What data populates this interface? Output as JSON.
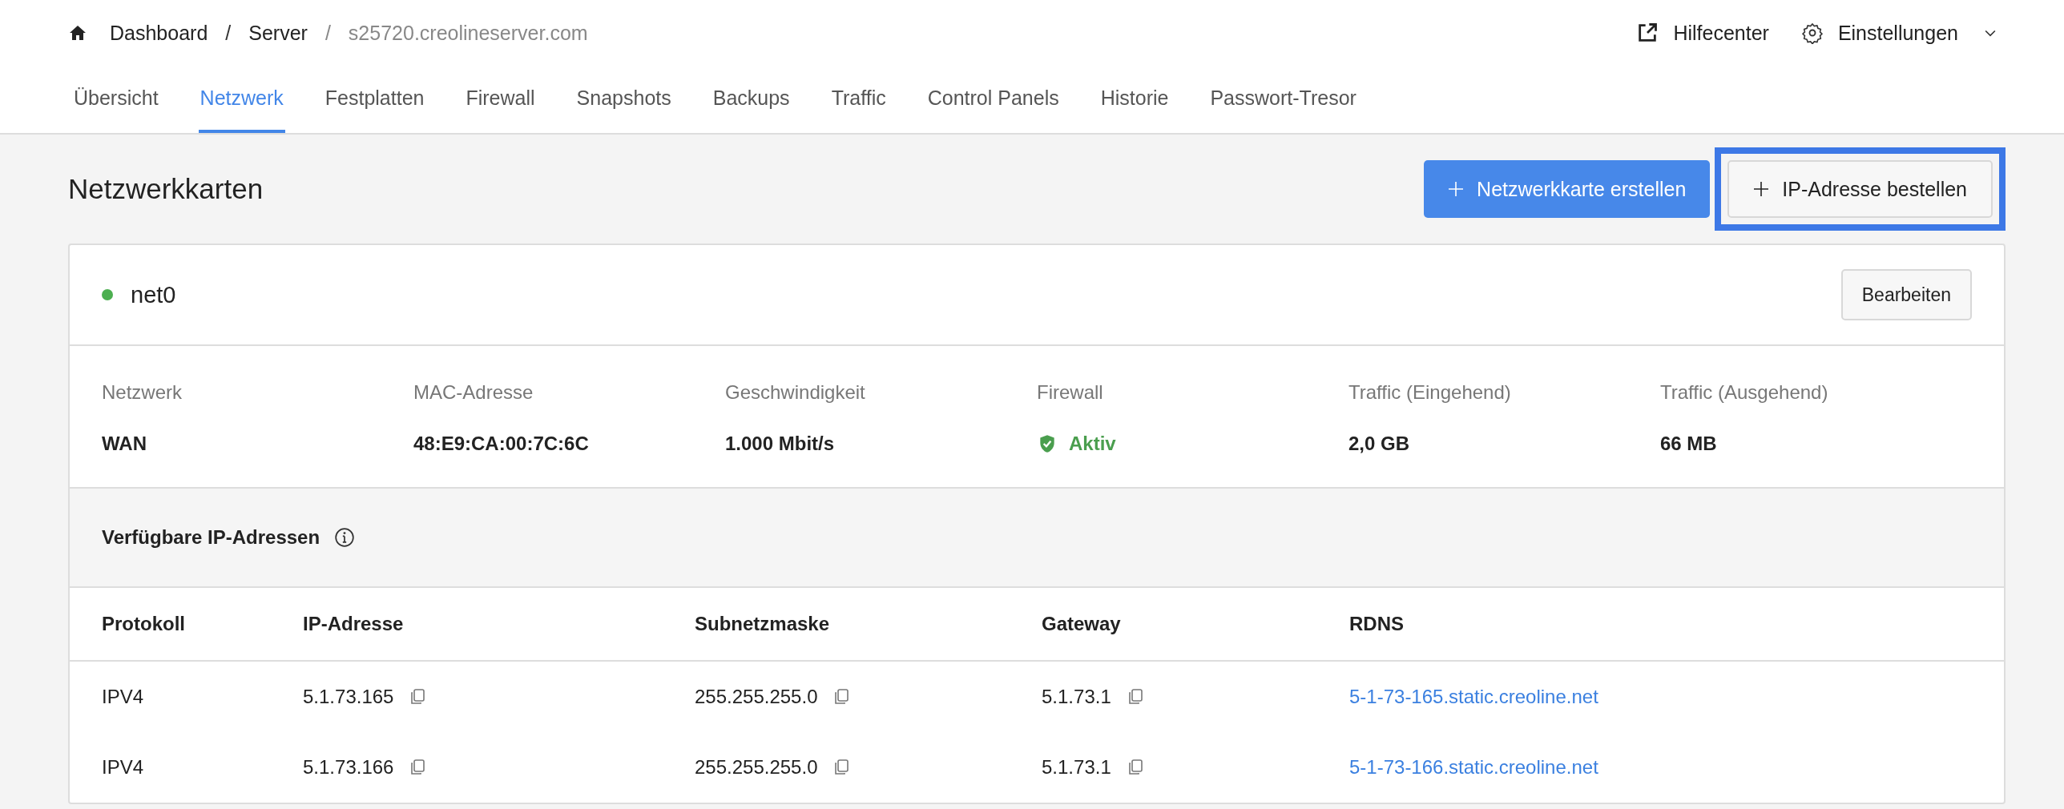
{
  "breadcrumb_separator": "/",
  "breadcrumbs": [
    {
      "label": "Dashboard",
      "current": false
    },
    {
      "label": "Server",
      "current": false
    },
    {
      "label": "s25720.creolineserver.com",
      "current": true
    }
  ],
  "header_links": {
    "help": "Hilfecenter",
    "settings": "Einstellungen"
  },
  "tabs": [
    {
      "label": "Übersicht",
      "selected": false
    },
    {
      "label": "Netzwerk",
      "selected": true
    },
    {
      "label": "Festplatten",
      "selected": false
    },
    {
      "label": "Firewall",
      "selected": false
    },
    {
      "label": "Snapshots",
      "selected": false
    },
    {
      "label": "Backups",
      "selected": false
    },
    {
      "label": "Traffic",
      "selected": false
    },
    {
      "label": "Control Panels",
      "selected": false
    },
    {
      "label": "Historie",
      "selected": false
    },
    {
      "label": "Passwort-Tresor",
      "selected": false
    }
  ],
  "page_title": "Netzwerkkarten",
  "actions": [
    {
      "label": "Netzwerkkarte erstellen",
      "kind": "primary",
      "highlighted": false
    },
    {
      "label": "IP-Adresse bestellen",
      "kind": "secondary",
      "highlighted": true
    }
  ],
  "card": {
    "name": "net0",
    "color": "#4caf50",
    "edit_button": "Bearbeiten",
    "details": [
      {
        "label": "Netzwerk",
        "value": "WAN",
        "kind": "text"
      },
      {
        "label": "MAC-Adresse",
        "value": "48:E9:CA:00:7C:6C",
        "kind": "text"
      },
      {
        "label": "Geschwindigkeit",
        "value": "1.000 Mbit/s",
        "kind": "text"
      },
      {
        "label": "Firewall",
        "value": "Aktiv",
        "kind": "status"
      },
      {
        "label": "Traffic (Eingehend)",
        "value": "2,0 GB",
        "kind": "text"
      },
      {
        "label": "Traffic (Ausgehend)",
        "value": "66 MB",
        "kind": "text"
      }
    ],
    "ip_section_title": "Verfügbare IP-Adressen",
    "table": {
      "columns": [
        "Protokoll",
        "IP-Adresse",
        "Subnetzmaske",
        "Gateway",
        "RDNS"
      ],
      "rows": [
        {
          "protocol": "IPV4",
          "ip": "5.1.73.165",
          "subnet": "255.255.255.0",
          "gateway": "5.1.73.1",
          "rdns": "5-1-73-165.static.creoline.net"
        },
        {
          "protocol": "IPV4",
          "ip": "5.1.73.166",
          "subnet": "255.255.255.0",
          "gateway": "5.1.73.1",
          "rdns": "5-1-73-166.static.creoline.net"
        }
      ]
    }
  }
}
